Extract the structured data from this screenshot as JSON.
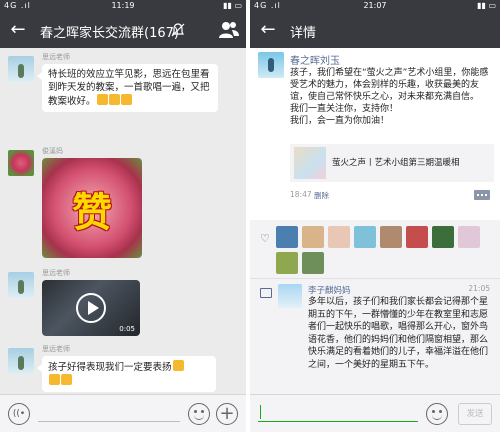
{
  "left": {
    "status": {
      "signal": "4G .ıl",
      "time": "11:19",
      "battery": "▮▮ ▭"
    },
    "header": {
      "back_glyph": "←",
      "title": "春之晖家长交流群(167)"
    },
    "messages": [
      {
        "sender": "思远老师",
        "text": "特长班的效应立竿见影，思远在包里看到昨天发的教案，一首歌唱一遍，又把教案收好。"
      },
      {
        "sender": "俊溪妈",
        "image_text": "赞"
      },
      {
        "sender": "思远老师",
        "video_duration": "0:05"
      },
      {
        "sender": "思远老师",
        "text": "孩子好得表现我们一定要表扬"
      }
    ],
    "input": {
      "voice_glyph": "((•",
      "plus_glyph": "+"
    }
  },
  "right": {
    "status": {
      "signal": "4G .ıl",
      "time": "21:07",
      "battery": "▮▮ ▭"
    },
    "header": {
      "back_glyph": "←",
      "title": "详情"
    },
    "post": {
      "author": "春之晖刘玉",
      "lines": [
        "孩子，我们希望在“萤火之声”艺术小组里，你能感受艺术的魅力，体会别样的乐趣，收获最美的友谊，使自己常怀快乐之心，对未来都充满自信。",
        "我们一直关注你，支持你！",
        "我们，会一直为你加油！"
      ],
      "link_title": "萤火之声丨艺术小组第三期温暖相",
      "time": "18:47",
      "delete_label": "删除"
    },
    "comment": {
      "author": "李子麒妈妈",
      "time": "21:05",
      "text": "多年以后，孩子们和我们家长都会记得那个星期五的下午，一群懵懂的少年在教室里和志愿者们一起快乐的唱歌，唱得那么开心，窗外鸟语花香，他们的妈妈们和他们隔窗相望，那么快乐满足的看着她们的儿子，幸福洋溢在他们之间，一个美好的星期五下午。"
    },
    "input": {
      "send_label": "发送"
    }
  },
  "colors": {
    "titlebar": "#393a3f",
    "link_blue": "#576b95",
    "wechat_green": "#1aad19"
  }
}
